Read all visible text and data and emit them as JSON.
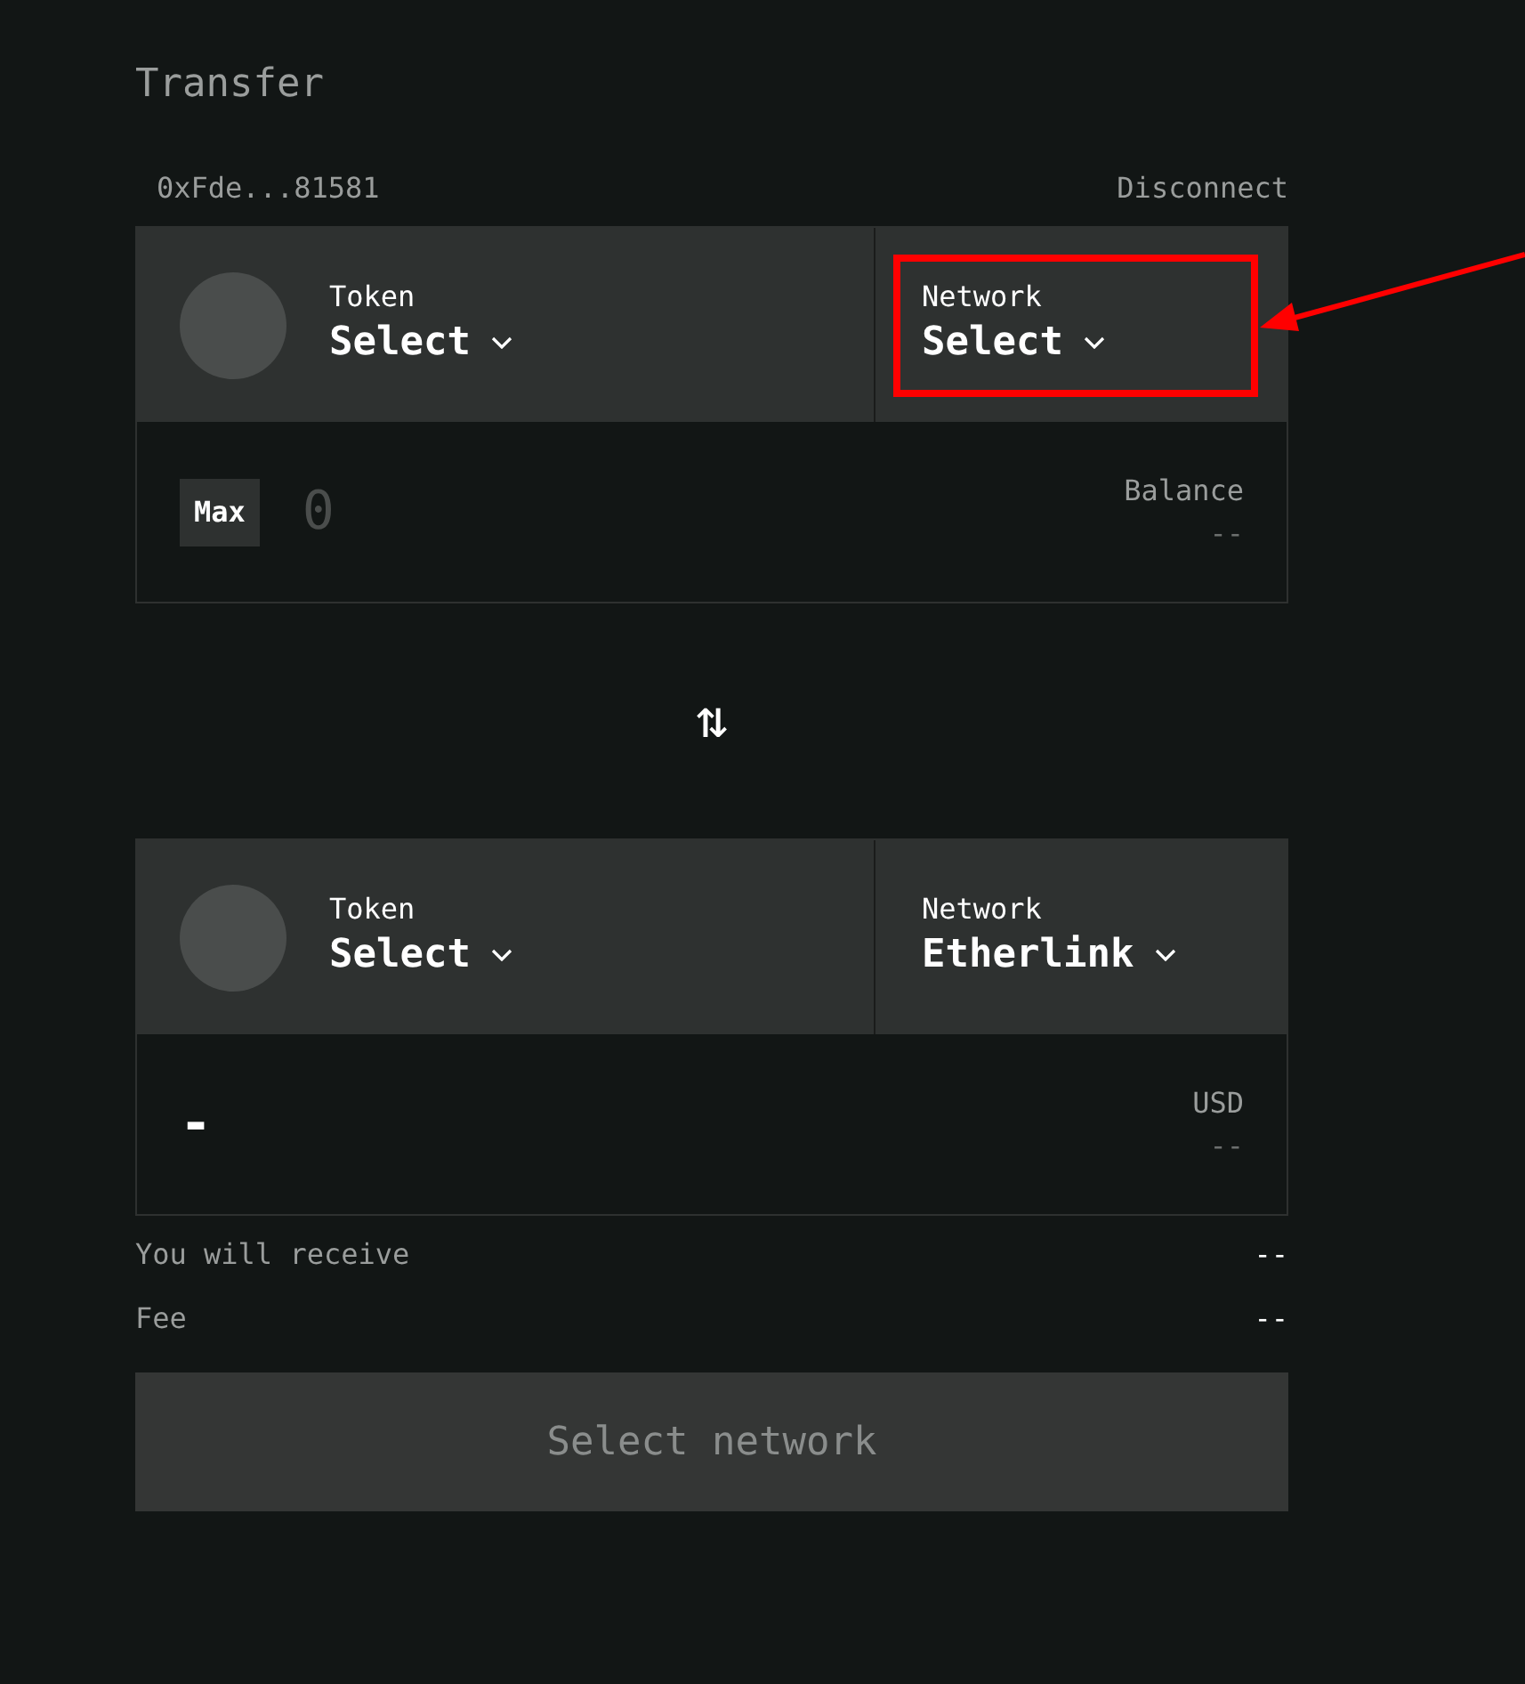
{
  "title": "Transfer",
  "account": {
    "address": "0xFde...81581",
    "disconnect": "Disconnect"
  },
  "from": {
    "token": {
      "label": "Token",
      "value": "Select"
    },
    "network": {
      "label": "Network",
      "value": "Select",
      "highlighted": true
    },
    "max": "Max",
    "amount": {
      "placeholder": "0"
    },
    "side": {
      "label": "Balance",
      "value": "--"
    }
  },
  "swap": {
    "symbol": "⇅"
  },
  "to": {
    "token": {
      "label": "Token",
      "value": "Select"
    },
    "network": {
      "label": "Network",
      "value": "Etherlink",
      "highlighted": false
    },
    "amount": {
      "value": "-"
    },
    "side": {
      "label": "USD",
      "value": "--"
    }
  },
  "summary": [
    {
      "label": "You will receive",
      "value": "--"
    },
    {
      "label": "Fee",
      "value": "--"
    }
  ],
  "submit": {
    "label": "Select network",
    "disabled": true
  }
}
